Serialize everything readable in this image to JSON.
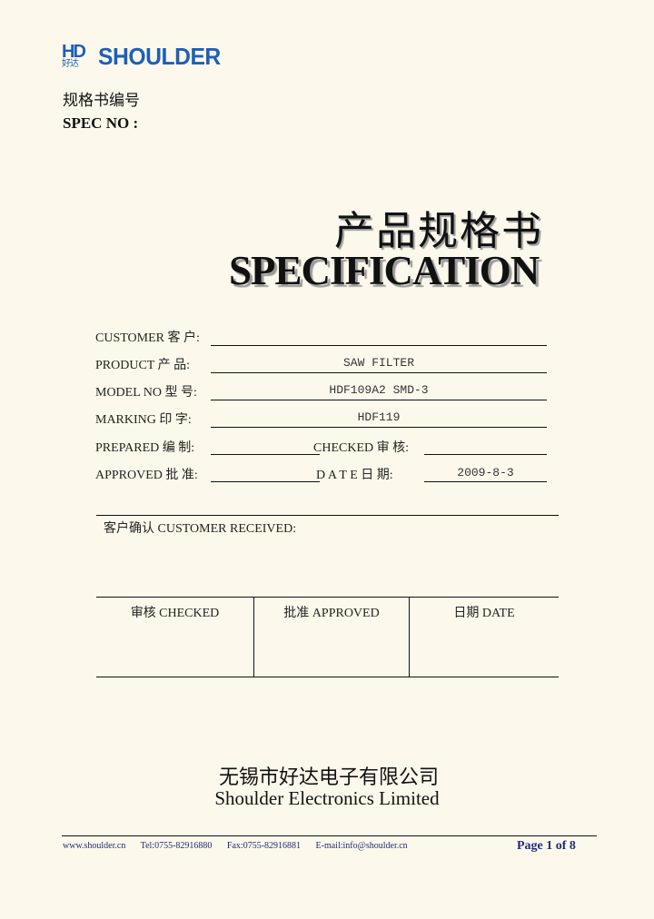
{
  "header": {
    "logo": {
      "mark": "HD",
      "mark_cn": "好达",
      "brand": "SHOULDER",
      "color": "#1f5fb6"
    },
    "spec_no_cn": "规格书编号",
    "spec_no_en": "SPEC NO :"
  },
  "title": {
    "cn": "产品规格书",
    "en": "SPECIFICATION"
  },
  "form": {
    "customer": {
      "label": "CUSTOMER 客  户:",
      "value": ""
    },
    "product": {
      "label": "PRODUCT   产  品:",
      "value": "SAW FILTER"
    },
    "model_no": {
      "label": "MODEL NO  型  号:",
      "value": "HDF109A2 SMD-3"
    },
    "marking": {
      "label": "MARKING   印  字:",
      "value": "HDF119"
    },
    "prepared": {
      "label": "PREPARED 编  制:",
      "value": ""
    },
    "checked": {
      "label": "CHECKED  审  核:",
      "value": ""
    },
    "approved": {
      "label": "APPROVED 批  准:",
      "value": ""
    },
    "date": {
      "label": "D  A  T  E  日  期:",
      "value": "2009-8-3"
    }
  },
  "customer_received": {
    "label": "客户确认 CUSTOMER RECEIVED:",
    "columns": [
      "审核 CHECKED",
      "批准 APPROVED",
      "日期 DATE"
    ]
  },
  "company": {
    "cn": "无锡市好达电子有限公司",
    "en": "Shoulder Electronics Limited"
  },
  "footer": {
    "website": "www.shoulder.cn",
    "tel": "Tel:0755-82916880",
    "fax": "Fax:0755-82916881",
    "email": "E-mail:info@shoulder.cn",
    "page": "Page 1 of 8",
    "color": "#1b2f7a"
  }
}
